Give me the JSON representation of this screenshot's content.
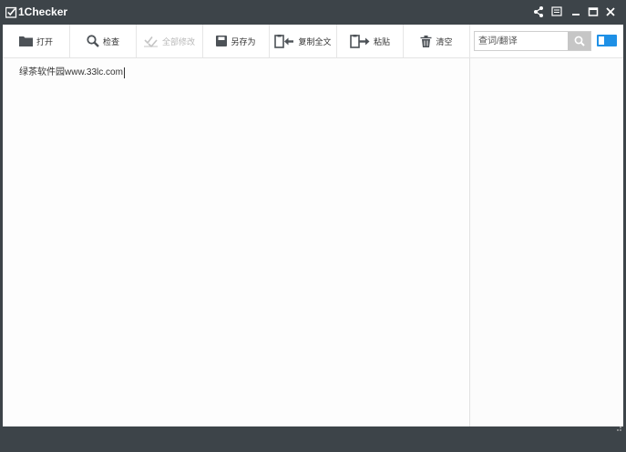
{
  "window": {
    "title": "1Checker"
  },
  "toolbar": {
    "open": "打开",
    "check": "检查",
    "fix_all": "全部修改",
    "save_as": "另存为",
    "copy_all": "复制全文",
    "paste": "粘贴",
    "clear": "清空"
  },
  "search": {
    "placeholder": "查词/翻译",
    "value": ""
  },
  "editor": {
    "text": "绿茶软件园www.33lc.com"
  },
  "colors": {
    "titlebar": "#3d4449",
    "accent": "#1e90e6",
    "disabled": "#b8b8b8"
  },
  "icons": [
    "app-logo-icon",
    "share-icon",
    "feedback-icon",
    "minimize-icon",
    "maximize-icon",
    "close-icon",
    "folder-icon",
    "magnifier-icon",
    "check-marks-icon",
    "save-icon",
    "copy-icon",
    "paste-icon",
    "trash-icon",
    "search-icon"
  ]
}
